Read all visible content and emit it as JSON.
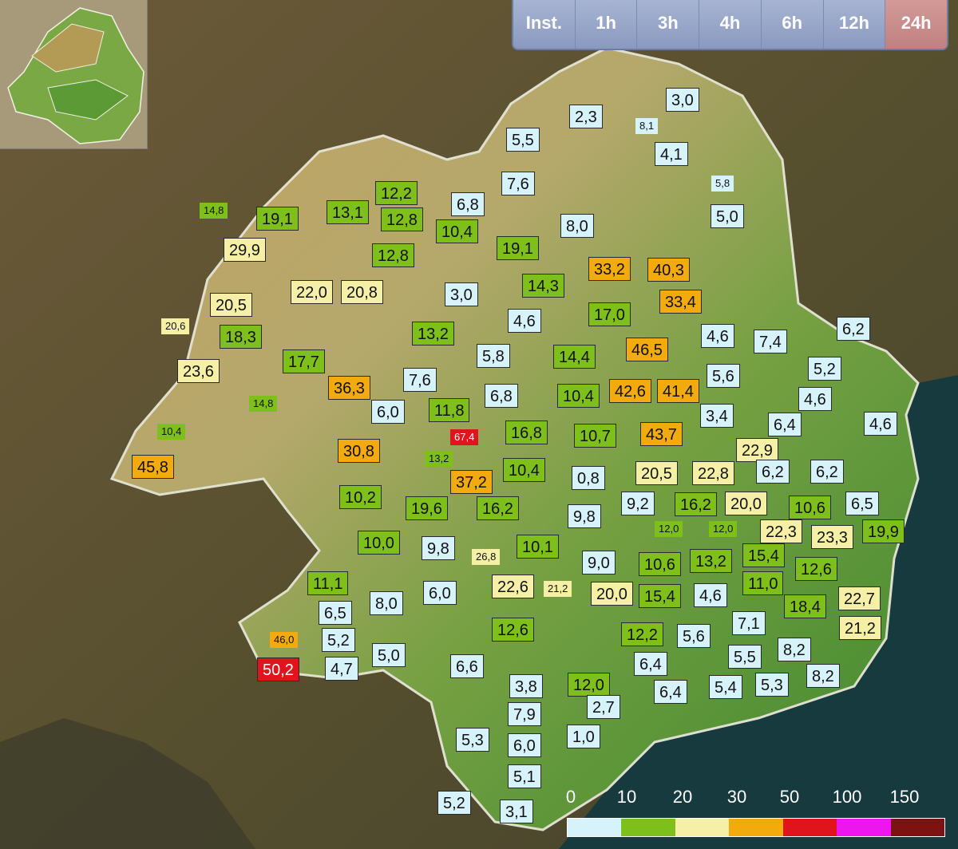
{
  "time_tabs": [
    {
      "label": "Inst.",
      "active": false
    },
    {
      "label": "1h",
      "active": false
    },
    {
      "label": "3h",
      "active": false
    },
    {
      "label": "4h",
      "active": false
    },
    {
      "label": "6h",
      "active": false
    },
    {
      "label": "12h",
      "active": false
    },
    {
      "label": "24h",
      "active": true
    }
  ],
  "legend": {
    "thresholds": [
      "0",
      "10",
      "20",
      "30",
      "50",
      "100",
      "150"
    ],
    "colors": [
      "#d6f3fb",
      "#7fbf1b",
      "#f6f0a6",
      "#f2aa0c",
      "#e0141c",
      "#ee16ee",
      "#7d1212"
    ]
  },
  "colors": {
    "class0": "#d6f3fb",
    "class1": "#7fbf1b",
    "class2": "#f6f0a6",
    "class3": "#f2aa0c",
    "class4": "#e0141c",
    "sea": "#173a3e",
    "region": "#4f9a3a"
  },
  "stations": [
    {
      "v": "2,3",
      "c": 0
    },
    {
      "v": "3,0",
      "c": 0
    },
    {
      "v": "8,1",
      "c": 0,
      "s": 1
    },
    {
      "v": "5,5",
      "c": 0
    },
    {
      "v": "4,1",
      "c": 0
    },
    {
      "v": "7,6",
      "c": 0
    },
    {
      "v": "5,8",
      "c": 0,
      "s": 1
    },
    {
      "v": "12,2",
      "c": 1
    },
    {
      "v": "14,8",
      "c": 1,
      "s": 1
    },
    {
      "v": "19,1",
      "c": 1
    },
    {
      "v": "13,1",
      "c": 1
    },
    {
      "v": "12,8",
      "c": 1
    },
    {
      "v": "6,8",
      "c": 0
    },
    {
      "v": "10,4",
      "c": 1
    },
    {
      "v": "8,0",
      "c": 0
    },
    {
      "v": "5,0",
      "c": 0
    },
    {
      "v": "29,9",
      "c": 2
    },
    {
      "v": "12,8",
      "c": 1
    },
    {
      "v": "19,1",
      "c": 1
    },
    {
      "v": "33,2",
      "c": 3
    },
    {
      "v": "40,3",
      "c": 3
    },
    {
      "v": "22,0",
      "c": 2
    },
    {
      "v": "20,8",
      "c": 2
    },
    {
      "v": "3,0",
      "c": 0
    },
    {
      "v": "14,3",
      "c": 1
    },
    {
      "v": "33,4",
      "c": 3
    },
    {
      "v": "20,5",
      "c": 2
    },
    {
      "v": "17,0",
      "c": 1
    },
    {
      "v": "20,6",
      "c": 2,
      "s": 1
    },
    {
      "v": "18,3",
      "c": 1
    },
    {
      "v": "4,6",
      "c": 0
    },
    {
      "v": "13,2",
      "c": 1
    },
    {
      "v": "4,6",
      "c": 0
    },
    {
      "v": "7,4",
      "c": 0
    },
    {
      "v": "6,2",
      "c": 0
    },
    {
      "v": "17,7",
      "c": 1
    },
    {
      "v": "5,8",
      "c": 0
    },
    {
      "v": "14,4",
      "c": 1
    },
    {
      "v": "46,5",
      "c": 3
    },
    {
      "v": "23,6",
      "c": 2
    },
    {
      "v": "5,2",
      "c": 0
    },
    {
      "v": "7,6",
      "c": 0
    },
    {
      "v": "5,6",
      "c": 0
    },
    {
      "v": "36,3",
      "c": 3
    },
    {
      "v": "42,6",
      "c": 3
    },
    {
      "v": "41,4",
      "c": 3
    },
    {
      "v": "6,8",
      "c": 0
    },
    {
      "v": "10,4",
      "c": 1
    },
    {
      "v": "4,6",
      "c": 0
    },
    {
      "v": "14,8",
      "c": 1,
      "s": 1
    },
    {
      "v": "6,0",
      "c": 0
    },
    {
      "v": "11,8",
      "c": 1
    },
    {
      "v": "3,4",
      "c": 0
    },
    {
      "v": "10,4",
      "c": 1,
      "s": 1
    },
    {
      "v": "6,4",
      "c": 0
    },
    {
      "v": "4,6",
      "c": 0
    },
    {
      "v": "67,4",
      "c": 4,
      "s": 1
    },
    {
      "v": "16,8",
      "c": 1
    },
    {
      "v": "10,7",
      "c": 1
    },
    {
      "v": "43,7",
      "c": 3
    },
    {
      "v": "22,9",
      "c": 2
    },
    {
      "v": "30,8",
      "c": 3
    },
    {
      "v": "13,2",
      "c": 1,
      "s": 1
    },
    {
      "v": "45,8",
      "c": 3
    },
    {
      "v": "10,4",
      "c": 1
    },
    {
      "v": "20,5",
      "c": 2
    },
    {
      "v": "22,8",
      "c": 2
    },
    {
      "v": "6,2",
      "c": 0
    },
    {
      "v": "6,2",
      "c": 0
    },
    {
      "v": "37,2",
      "c": 3
    },
    {
      "v": "0,8",
      "c": 0
    },
    {
      "v": "10,2",
      "c": 1
    },
    {
      "v": "19,6",
      "c": 1
    },
    {
      "v": "16,2",
      "c": 1
    },
    {
      "v": "9,2",
      "c": 0
    },
    {
      "v": "16,2",
      "c": 1
    },
    {
      "v": "20,0",
      "c": 2
    },
    {
      "v": "10,6",
      "c": 1
    },
    {
      "v": "6,5",
      "c": 0
    },
    {
      "v": "9,8",
      "c": 0
    },
    {
      "v": "12,0",
      "c": 1,
      "s": 1
    },
    {
      "v": "12,0",
      "c": 1,
      "s": 1
    },
    {
      "v": "22,3",
      "c": 2
    },
    {
      "v": "23,3",
      "c": 2
    },
    {
      "v": "19,9",
      "c": 1
    },
    {
      "v": "10,0",
      "c": 1
    },
    {
      "v": "9,8",
      "c": 0
    },
    {
      "v": "26,8",
      "c": 2,
      "s": 1
    },
    {
      "v": "10,1",
      "c": 1
    },
    {
      "v": "9,0",
      "c": 0
    },
    {
      "v": "10,6",
      "c": 1
    },
    {
      "v": "13,2",
      "c": 1
    },
    {
      "v": "15,4",
      "c": 1
    },
    {
      "v": "12,6",
      "c": 1
    },
    {
      "v": "11,1",
      "c": 1
    },
    {
      "v": "22,6",
      "c": 2
    },
    {
      "v": "21,2",
      "c": 2,
      "s": 1
    },
    {
      "v": "11,0",
      "c": 1
    },
    {
      "v": "8,0",
      "c": 0
    },
    {
      "v": "6,0",
      "c": 0
    },
    {
      "v": "20,0",
      "c": 2
    },
    {
      "v": "15,4",
      "c": 1
    },
    {
      "v": "4,6",
      "c": 0
    },
    {
      "v": "22,7",
      "c": 2
    },
    {
      "v": "6,5",
      "c": 0
    },
    {
      "v": "18,4",
      "c": 1
    },
    {
      "v": "7,1",
      "c": 0
    },
    {
      "v": "21,2",
      "c": 2
    },
    {
      "v": "46,0",
      "c": 3,
      "s": 1
    },
    {
      "v": "5,2",
      "c": 0
    },
    {
      "v": "12,6",
      "c": 1
    },
    {
      "v": "12,2",
      "c": 1
    },
    {
      "v": "5,6",
      "c": 0
    },
    {
      "v": "8,2",
      "c": 0
    },
    {
      "v": "50,2",
      "c": 4
    },
    {
      "v": "4,7",
      "c": 0
    },
    {
      "v": "5,0",
      "c": 0
    },
    {
      "v": "6,6",
      "c": 0
    },
    {
      "v": "5,5",
      "c": 0
    },
    {
      "v": "8,2",
      "c": 0
    },
    {
      "v": "6,4",
      "c": 0
    },
    {
      "v": "3,8",
      "c": 0
    },
    {
      "v": "12,0",
      "c": 1
    },
    {
      "v": "6,4",
      "c": 0
    },
    {
      "v": "5,4",
      "c": 0
    },
    {
      "v": "5,3",
      "c": 0
    },
    {
      "v": "7,9",
      "c": 0
    },
    {
      "v": "2,7",
      "c": 0
    },
    {
      "v": "5,3",
      "c": 0
    },
    {
      "v": "6,0",
      "c": 0
    },
    {
      "v": "1,0",
      "c": 0
    },
    {
      "v": "5,1",
      "c": 0
    },
    {
      "v": "5,2",
      "c": 0
    },
    {
      "v": "3,1",
      "c": 0
    }
  ]
}
